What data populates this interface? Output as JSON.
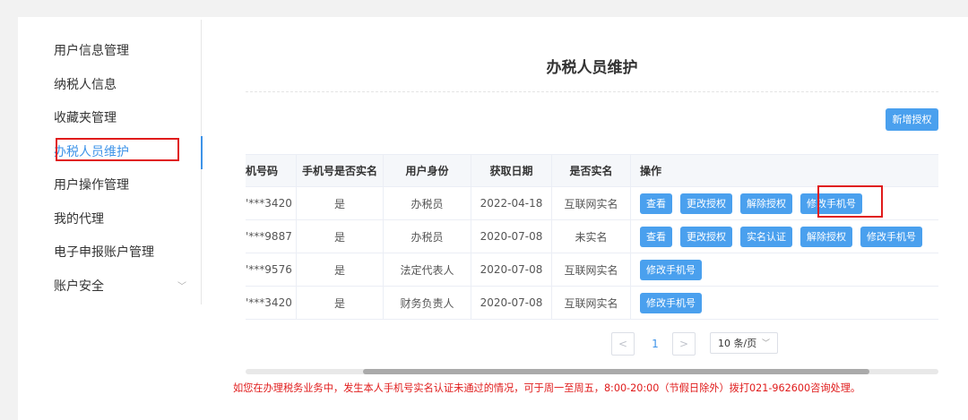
{
  "sidebar": {
    "items": [
      {
        "label": "用户信息管理"
      },
      {
        "label": "纳税人信息"
      },
      {
        "label": "收藏夹管理"
      },
      {
        "label": "办税人员维护",
        "active": true
      },
      {
        "label": "用户操作管理"
      },
      {
        "label": "我的代理"
      },
      {
        "label": "电子申报账户管理"
      },
      {
        "label": "账户安全",
        "has_chevron": true
      }
    ]
  },
  "page": {
    "title": "办税人员维护",
    "add_button": "新增授权"
  },
  "table": {
    "headers": [
      "机号码",
      "手机号是否实名",
      "用户身份",
      "获取日期",
      "是否实名",
      "操作"
    ],
    "rows": [
      {
        "phone": "'***3420",
        "phone_verified": "是",
        "role": "办税员",
        "date": "2022-04-18",
        "realname": "互联网实名",
        "actions": [
          "查看",
          "更改授权",
          "解除授权",
          "修改手机号"
        ]
      },
      {
        "phone": "'***9887",
        "phone_verified": "是",
        "role": "办税员",
        "date": "2020-07-08",
        "realname": "未实名",
        "actions": [
          "查看",
          "更改授权",
          "实名认证",
          "解除授权",
          "修改手机号"
        ]
      },
      {
        "phone": "'***9576",
        "phone_verified": "是",
        "role": "法定代表人",
        "date": "2020-07-08",
        "realname": "互联网实名",
        "actions": [
          "修改手机号"
        ]
      },
      {
        "phone": "'***3420",
        "phone_verified": "是",
        "role": "财务负责人",
        "date": "2020-07-08",
        "realname": "互联网实名",
        "actions": [
          "修改手机号"
        ]
      }
    ]
  },
  "pagination": {
    "current_page": "1",
    "page_size": "10 条/页",
    "prev_icon": "chevron-left-icon",
    "next_icon": "chevron-right-icon"
  },
  "horizontal_scroll_position": 0.25,
  "notice": "如您在办理税务业务中，发生本人手机号实名认证未通过的情况，可于周一至周五，8:00-20:00（节假日除外）拨打021-962600咨询处理。",
  "colors": {
    "accent": "#3e93e8",
    "button": "#4aa0ee",
    "highlight": "#e01b1b",
    "notice": "#e01b1b"
  }
}
